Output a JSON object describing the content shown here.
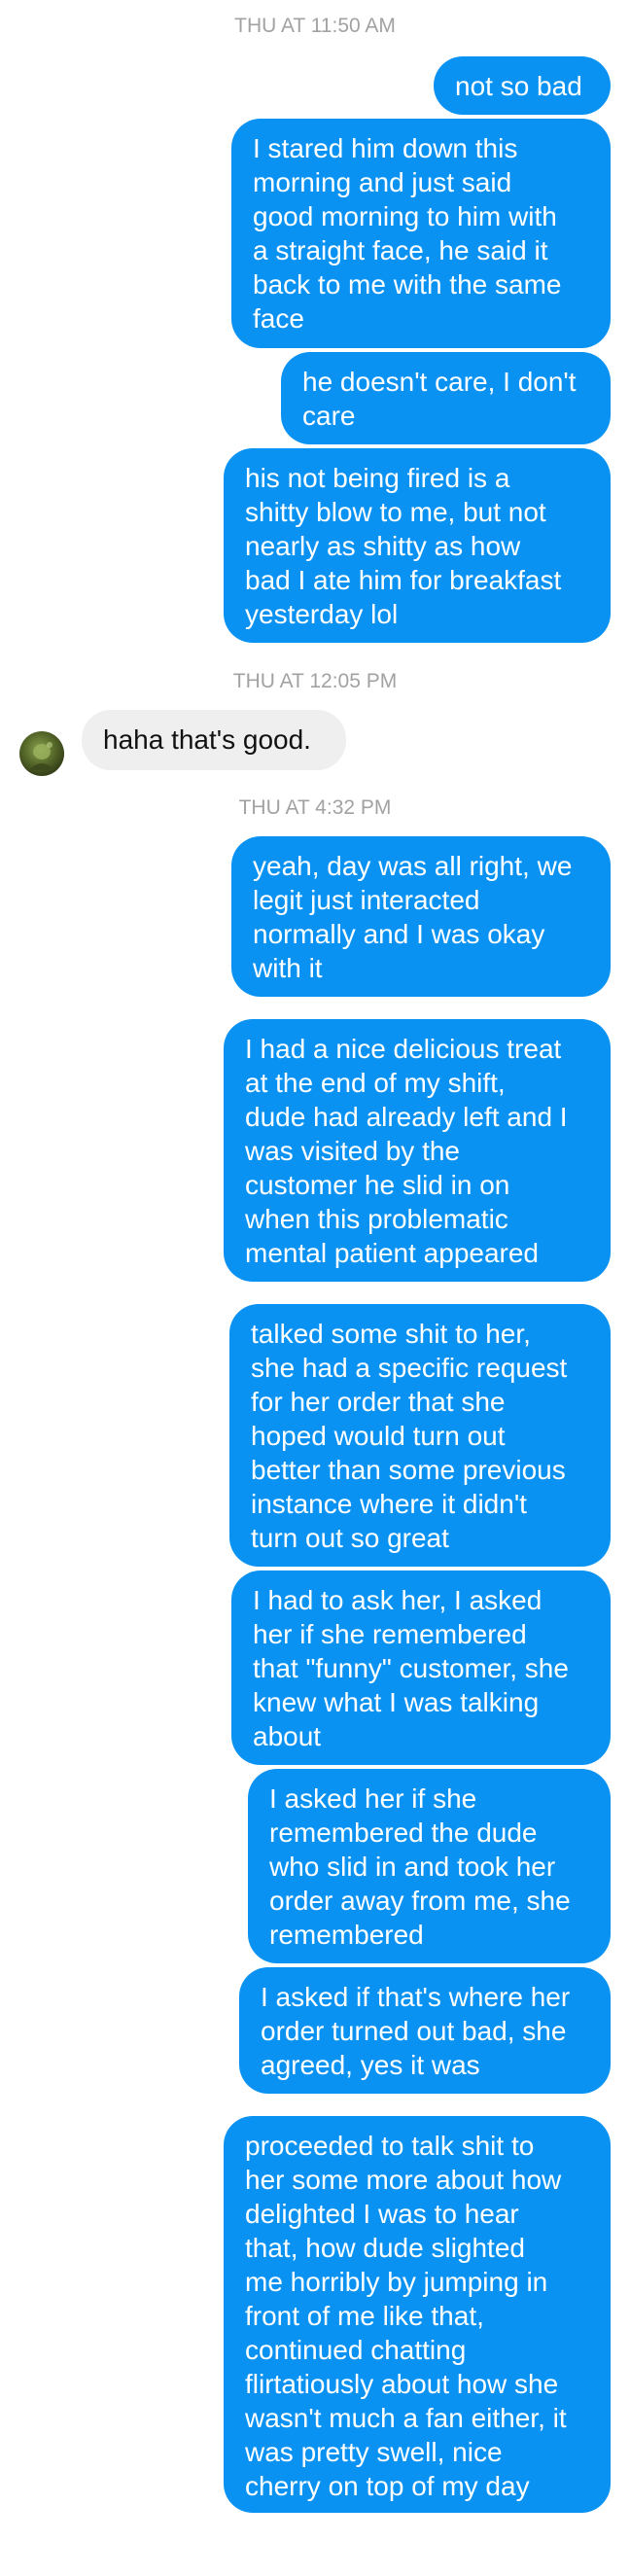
{
  "timestamps": {
    "t1": "THU AT 11:50 AM",
    "t2": "THU AT 12:05 PM",
    "t3": "THU AT 4:32 PM"
  },
  "messages": [
    {
      "from": "me",
      "text": "not so bad"
    },
    {
      "from": "me",
      "text": "I stared him down this\nmorning and just said\ngood morning to him with\na straight face, he said it\nback to me with the same\nface"
    },
    {
      "from": "me",
      "text": "he doesn't care, I don't\ncare"
    },
    {
      "from": "me",
      "text": "his not being fired is a\nshitty blow to me, but not\nnearly as shitty as how\nbad I ate him for breakfast\nyesterday lol"
    },
    {
      "from": "them",
      "text": "haha that's good."
    },
    {
      "from": "me",
      "text": "yeah, day was all right, we\nlegit just interacted\nnormally and I was okay\nwith it"
    },
    {
      "from": "me",
      "text": "I had a nice delicious treat\nat the end of my shift,\ndude had already left and I\nwas visited by the\ncustomer he slid in on\nwhen this problematic\nmental patient appeared"
    },
    {
      "from": "me",
      "text": "talked some shit to her,\nshe had a specific request\nfor her order that she\nhoped would turn out\nbetter than some previous\ninstance where it didn't\nturn out so great"
    },
    {
      "from": "me",
      "text": "I had to ask her, I asked\nher if she remembered\nthat \"funny\" customer, she\nknew what I was talking\nabout"
    },
    {
      "from": "me",
      "text": "I asked her if she\nremembered the dude\nwho slid in and took her\norder away from me, she\nremembered"
    },
    {
      "from": "me",
      "text": "I asked if that's where her\norder turned out bad, she\nagreed, yes it was"
    },
    {
      "from": "me",
      "text": "proceeded to talk shit to\nher some more about how\ndelighted I was to hear\nthat, how dude slighted\nme horribly by jumping in\nfront of me like that,\ncontinued chatting\nflirtatiously about how she\nwasn't much a fan either, it\nwas pretty swell, nice\ncherry on top of my day"
    }
  ],
  "colors": {
    "outgoing_bubble": "#0a92f3",
    "incoming_bubble": "#efefef",
    "timestamp_text": "#a2a2a2"
  },
  "icons": {
    "contact_avatar": "contact-avatar"
  }
}
